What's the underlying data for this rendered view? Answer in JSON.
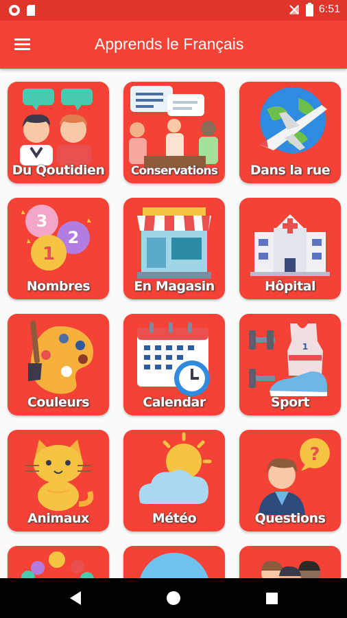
{
  "status_bar": {
    "time": "6:51"
  },
  "app_bar": {
    "title": "Apprends le Français",
    "menu_icon": "hamburger-menu-icon"
  },
  "categories": [
    {
      "label": "Du Qoutidien",
      "icon": "people-chatting-icon"
    },
    {
      "label": "Conservations",
      "icon": "meeting-icon"
    },
    {
      "label": "Dans la rue",
      "icon": "airplane-globe-icon"
    },
    {
      "label": "Nombres",
      "icon": "number-balloons-icon"
    },
    {
      "label": "En Magasin",
      "icon": "shop-icon"
    },
    {
      "label": "Hôpital",
      "icon": "hospital-icon"
    },
    {
      "label": "Couleurs",
      "icon": "palette-icon"
    },
    {
      "label": "Calendar",
      "icon": "calendar-clock-icon"
    },
    {
      "label": "Sport",
      "icon": "sport-gear-icon"
    },
    {
      "label": "Animaux",
      "icon": "cat-icon"
    },
    {
      "label": "Météo",
      "icon": "weather-icon"
    },
    {
      "label": "Questions",
      "icon": "question-person-icon"
    }
  ],
  "colors": {
    "primary": "#F44336",
    "primary_dark": "#E0352B",
    "background": "#FAFAFA"
  }
}
